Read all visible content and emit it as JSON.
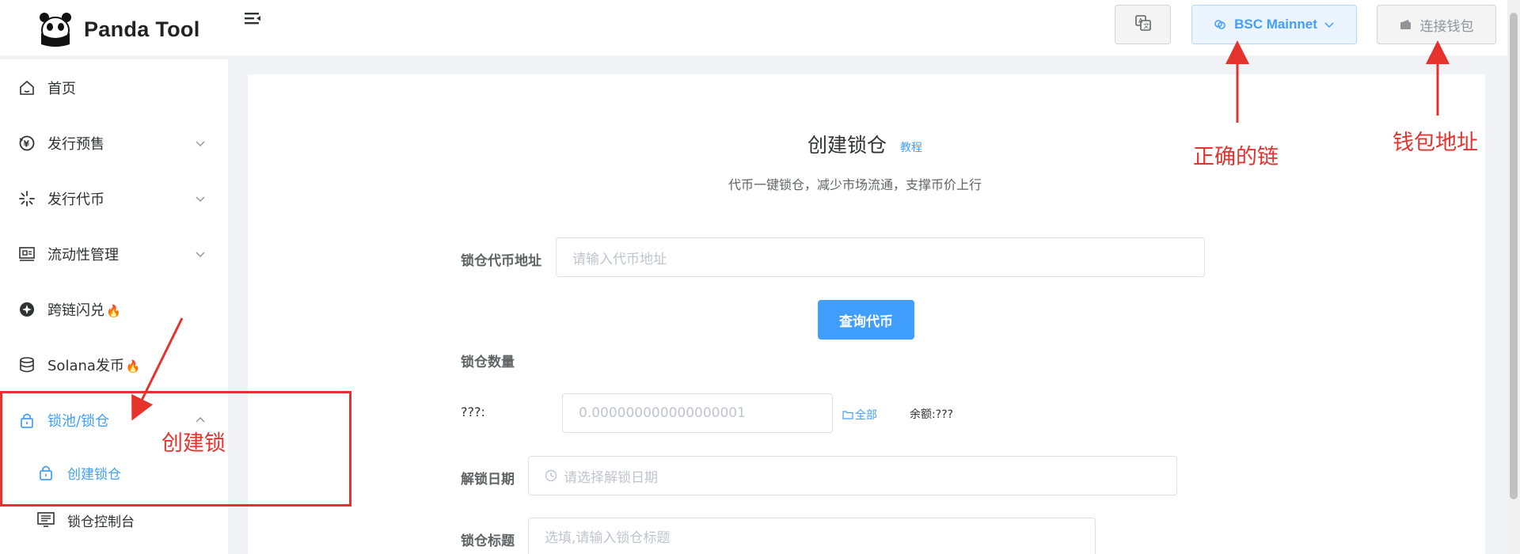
{
  "app": {
    "name": "Panda Tool"
  },
  "header": {
    "network_label": "BSC Mainnet",
    "wallet_label": "连接钱包"
  },
  "sidebar": {
    "items": [
      {
        "label": "首页",
        "icon": "home-icon"
      },
      {
        "label": "发行预售",
        "icon": "coin-icon",
        "expandable": true
      },
      {
        "label": "发行代币",
        "icon": "sparkle-icon",
        "expandable": true
      },
      {
        "label": "流动性管理",
        "icon": "liquidity-icon",
        "expandable": true
      },
      {
        "label": "跨链闪兑",
        "icon": "bridge-icon",
        "badge": "🔥"
      },
      {
        "label": "Solana发币",
        "icon": "database-icon",
        "badge": "🔥"
      },
      {
        "label": "锁池/锁仓",
        "icon": "lock-icon",
        "expanded": true,
        "active": true
      }
    ],
    "sub_items": [
      {
        "label": "创建锁仓",
        "icon": "lock-icon",
        "active": true
      },
      {
        "label": "锁仓控制台",
        "icon": "console-icon"
      }
    ]
  },
  "main": {
    "title": "创建锁仓",
    "tutorial_link": "教程",
    "subtitle": "代币一键锁仓，减少市场流通，支撑币价上行",
    "token_address": {
      "label": "锁仓代币地址",
      "placeholder": "请输入代币地址"
    },
    "query_button": "查询代币",
    "lock_amount": {
      "label": "锁仓数量",
      "token_symbol": "???:",
      "placeholder": "0.000000000000000001",
      "all_button": "全部",
      "balance": "余额:???"
    },
    "unlock_date": {
      "label": "解锁日期",
      "placeholder": "请选择解锁日期"
    },
    "lock_title": {
      "label": "锁仓标题",
      "placeholder": "选填,请输入锁仓标题"
    }
  },
  "annotations": {
    "correct_chain": "正确的链",
    "wallet_address": "钱包地址",
    "create_lock": "创建锁"
  },
  "colors": {
    "primary": "#409eff",
    "annotation": "#e5322d",
    "background": "#f0f2f5"
  }
}
